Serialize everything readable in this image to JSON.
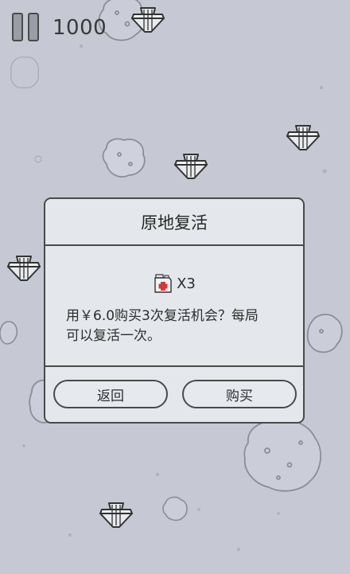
{
  "hud": {
    "pause_icon": "pause-icon",
    "score": "1000"
  },
  "background": {
    "enemy_icon": "enemy-plane-icon",
    "rock_icon": "asteroid-icon"
  },
  "dialog": {
    "title": "原地复活",
    "item_icon": "fuel-can-icon",
    "item_quantity": "X3",
    "message_line1": "用￥6.0购买3次复活机会？每局",
    "message_line2": "可以复活一次。",
    "back_label": "返回",
    "buy_label": "购买"
  },
  "colors": {
    "background": "#c6c9d4",
    "dialog_fill": "#e4e8ec",
    "outline": "#4a4a4a",
    "item_red": "#d23a3a"
  }
}
